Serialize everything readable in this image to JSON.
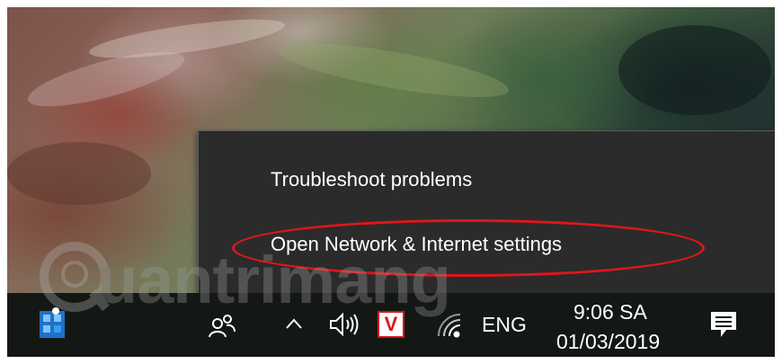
{
  "context_menu": {
    "items": [
      {
        "label": "Troubleshoot problems"
      },
      {
        "label": "Open Network & Internet settings"
      }
    ],
    "highlight_color": "#e0161a"
  },
  "taskbar": {
    "icons": [
      "app-cube-icon",
      "people-icon",
      "chevron-up-icon",
      "speaker-icon",
      "v-app-icon",
      "wifi-icon",
      "action-center-icon"
    ],
    "language": "ENG",
    "time": "9:06 SA",
    "date": "01/03/2019",
    "v_app_label": "V",
    "v_app_color": "#d9161c"
  },
  "watermark": {
    "text": "uantrimang"
  }
}
